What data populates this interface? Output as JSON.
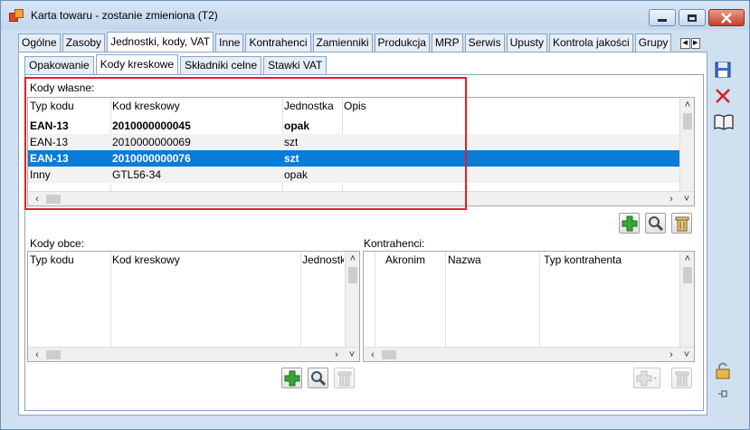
{
  "window": {
    "title": "Karta towaru - zostanie zmieniona (T2)"
  },
  "tabs": [
    {
      "label": "Ogólne"
    },
    {
      "label": "Zasoby"
    },
    {
      "label": "Jednostki, kody, VAT"
    },
    {
      "label": "Inne"
    },
    {
      "label": "Kontrahenci"
    },
    {
      "label": "Zamienniki"
    },
    {
      "label": "Produkcja"
    },
    {
      "label": "MRP"
    },
    {
      "label": "Serwis"
    },
    {
      "label": "Upusty"
    },
    {
      "label": "Kontrola jakości"
    },
    {
      "label": "Grupy"
    }
  ],
  "subtabs": [
    {
      "label": "Opakowanie"
    },
    {
      "label": "Kody kreskowe"
    },
    {
      "label": "Składniki celne"
    },
    {
      "label": "Stawki VAT"
    }
  ],
  "own_codes": {
    "label": "Kody własne:",
    "columns": [
      "Typ kodu",
      "Kod kreskowy",
      "Jednostka",
      "Opis"
    ],
    "rows": [
      {
        "type": "EAN-13",
        "code": "2010000000045",
        "unit": "opak",
        "desc": ""
      },
      {
        "type": "EAN-13",
        "code": "2010000000069",
        "unit": "szt",
        "desc": ""
      },
      {
        "type": "EAN-13",
        "code": "2010000000076",
        "unit": "szt",
        "desc": ""
      },
      {
        "type": "Inny",
        "code": "GTL56-34",
        "unit": "opak",
        "desc": ""
      }
    ]
  },
  "foreign_codes": {
    "label": "Kody obce:",
    "columns": [
      "Typ kodu",
      "Kod kreskowy",
      "Jednostka"
    ]
  },
  "contractors": {
    "label": "Kontrahenci:",
    "columns": [
      "Akronim",
      "Nazwa",
      "Typ kontrahenta"
    ]
  },
  "colors": {
    "selection": "#0a7bd6",
    "highlight_frame": "#e0202a",
    "add_icon": "#3aa53a",
    "delete_icon": "#d62020"
  }
}
